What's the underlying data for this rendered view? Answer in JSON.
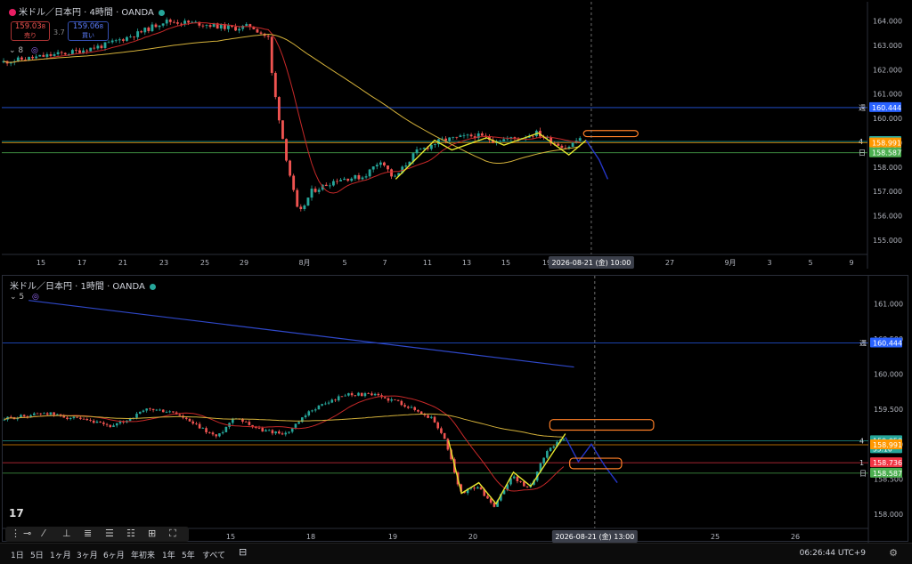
{
  "top": {
    "title": "米ドル／日本円 · 4時間 · OANDA",
    "sell_price": "159.03",
    "sell_suffix": "8",
    "sell_label": "売り",
    "spread": "3.7",
    "buy_price": "159.06",
    "buy_suffix": "8",
    "buy_label": "買い",
    "indicator_count": "8",
    "price_axis": [
      "164.000",
      "163.000",
      "162.000",
      "161.000",
      "160.000",
      "159.000",
      "158.000",
      "157.000",
      "156.000",
      "155.000"
    ],
    "time_axis": [
      "15",
      "17",
      "21",
      "23",
      "25",
      "29",
      "8月",
      "5",
      "7",
      "11",
      "13",
      "15",
      "19",
      "27",
      "9月",
      "3",
      "5",
      "9"
    ],
    "cursor_label": "2026-08-21 (金)   10:00",
    "line_labels": [
      {
        "tag": "週",
        "value": "160.444",
        "color": "#2962ff"
      },
      {
        "tag": "4",
        "value": "159.050",
        "sub": "03:33:16",
        "color": "#26a69a"
      },
      {
        "tag": "日",
        "value": "158.587",
        "color": "#4caf50"
      },
      {
        "tag": "",
        "value": "158.991",
        "color": "#ff9800"
      }
    ]
  },
  "bottom": {
    "title": "米ドル／日本円 · 1時間 · OANDA",
    "indicator_count": "5",
    "price_axis": [
      "161.000",
      "160.500",
      "160.000",
      "159.500",
      "159.000",
      "158.500",
      "158.000"
    ],
    "time_axis": [
      "15",
      "18",
      "19",
      "20",
      "25",
      "26"
    ],
    "cursor_label": "2026-08-21 (金)   13:00",
    "line_labels": [
      {
        "tag": "週",
        "value": "160.444",
        "color": "#2962ff"
      },
      {
        "tag": "4",
        "value": "159.050",
        "sub": "33:16",
        "color": "#26a69a"
      },
      {
        "tag": "",
        "value": "158.991",
        "color": "#ff9800"
      },
      {
        "tag": "1",
        "value": "158.736",
        "color": "#f23645"
      },
      {
        "tag": "日",
        "value": "158.587",
        "color": "#4caf50"
      }
    ]
  },
  "bottombar": {
    "timeframes": [
      "1日",
      "5日",
      "1ヶ月",
      "3ヶ月",
      "6ヶ月",
      "年初来",
      "1年",
      "5年",
      "すべて"
    ],
    "clock": "06:26:44 UTC+9"
  },
  "colors": {
    "up": "#26a69a",
    "down": "#ef5350",
    "ma_fast": "#c62828",
    "ma_slow": "#d4b13a",
    "zigzag": "#e6e62e",
    "forecast": "#2536c9",
    "box": "#ff7f27"
  },
  "chart_data": [
    {
      "type": "candlestick",
      "title": "米ドル／日本円 · 4時間 · OANDA",
      "ylim": [
        154.7,
        164.5
      ],
      "x_ticks": [
        "15",
        "17",
        "21",
        "23",
        "25",
        "29",
        "8月",
        "5",
        "7",
        "11",
        "13",
        "15",
        "19",
        "27",
        "9月",
        "3",
        "5",
        "9"
      ],
      "anchors": [
        [
          0,
          162.3
        ],
        [
          0.04,
          162.5
        ],
        [
          0.08,
          162.7
        ],
        [
          0.12,
          163.0
        ],
        [
          0.16,
          163.5
        ],
        [
          0.19,
          164.0
        ],
        [
          0.23,
          163.9
        ],
        [
          0.27,
          163.7
        ],
        [
          0.29,
          163.8
        ],
        [
          0.31,
          163.3
        ],
        [
          0.315,
          161.5
        ],
        [
          0.33,
          158.5
        ],
        [
          0.345,
          156.0
        ],
        [
          0.36,
          157.0
        ],
        [
          0.39,
          157.5
        ],
        [
          0.42,
          157.6
        ],
        [
          0.44,
          158.3
        ],
        [
          0.455,
          157.5
        ],
        [
          0.48,
          158.6
        ],
        [
          0.51,
          159.1
        ],
        [
          0.53,
          159.2
        ],
        [
          0.55,
          159.3
        ],
        [
          0.57,
          159.1
        ],
        [
          0.6,
          159.2
        ],
        [
          0.62,
          159.4
        ],
        [
          0.64,
          159.0
        ],
        [
          0.655,
          158.8
        ],
        [
          0.67,
          159.2
        ]
      ],
      "levels": [
        {
          "name": "週",
          "value": 160.444
        },
        {
          "name": "4",
          "value": 159.05
        },
        {
          "name": "日",
          "value": 158.587
        },
        {
          "name": "",
          "value": 158.991
        }
      ]
    },
    {
      "type": "candlestick",
      "title": "米ドル／日本円 · 1時間 · OANDA",
      "ylim": [
        157.9,
        161.3
      ],
      "x_ticks": [
        "15",
        "18",
        "19",
        "20",
        "25",
        "26"
      ],
      "anchors": [
        [
          0,
          159.35
        ],
        [
          0.05,
          159.45
        ],
        [
          0.09,
          159.35
        ],
        [
          0.13,
          159.25
        ],
        [
          0.17,
          159.5
        ],
        [
          0.2,
          159.45
        ],
        [
          0.22,
          159.3
        ],
        [
          0.25,
          159.1
        ],
        [
          0.27,
          159.4
        ],
        [
          0.3,
          159.2
        ],
        [
          0.33,
          159.15
        ],
        [
          0.36,
          159.5
        ],
        [
          0.4,
          159.72
        ],
        [
          0.43,
          159.7
        ],
        [
          0.46,
          159.6
        ],
        [
          0.5,
          159.35
        ],
        [
          0.515,
          159.0
        ],
        [
          0.53,
          158.3
        ],
        [
          0.55,
          158.4
        ],
        [
          0.57,
          158.1
        ],
        [
          0.59,
          158.55
        ],
        [
          0.61,
          158.35
        ],
        [
          0.63,
          158.9
        ],
        [
          0.65,
          159.1
        ]
      ],
      "levels": [
        {
          "name": "週",
          "value": 160.444
        },
        {
          "name": "4",
          "value": 159.05
        },
        {
          "name": "",
          "value": 158.991
        },
        {
          "name": "1",
          "value": 158.736
        },
        {
          "name": "日",
          "value": 158.587
        }
      ]
    }
  ]
}
